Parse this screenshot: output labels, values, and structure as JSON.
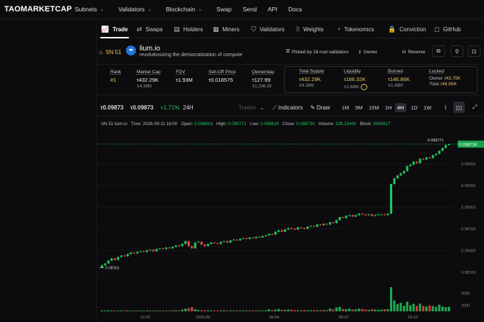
{
  "app": {
    "logo": "TAOMARKETCAP"
  },
  "topnav": [
    {
      "label": "Subnets",
      "chevron": true
    },
    {
      "label": "Validators",
      "chevron": true
    },
    {
      "label": "Blockchain",
      "chevron": true
    },
    {
      "label": "Swap",
      "chevron": false
    },
    {
      "label": "Send",
      "chevron": false
    },
    {
      "label": "API",
      "chevron": false
    },
    {
      "label": "Docs",
      "chevron": false
    }
  ],
  "tabs": [
    {
      "label": "Trade",
      "icon": "chart-line-icon",
      "glyph": "📈"
    },
    {
      "label": "Swaps",
      "icon": "swap-icon",
      "glyph": "⇄"
    },
    {
      "label": "Holders",
      "icon": "holders-icon",
      "glyph": "▤"
    },
    {
      "label": "Miners",
      "icon": "miner-icon",
      "glyph": "▦"
    },
    {
      "label": "Validators",
      "icon": "shield-icon",
      "glyph": "⛉"
    },
    {
      "label": "Weights",
      "icon": "grid-dots-icon",
      "glyph": "⁞⁞"
    },
    {
      "label": "Tokenomics",
      "icon": "pie-icon",
      "glyph": "◔"
    },
    {
      "label": "Conviction",
      "icon": "lock-icon",
      "glyph": "🔒"
    },
    {
      "label": "GitHub",
      "icon": "github-icon",
      "glyph": "◻"
    }
  ],
  "subnet": {
    "sn_label": "SN 51",
    "name": "lium.io",
    "tagline": "revolutionizing the democratization of compute",
    "picked_by": "Picked by 18 root validators",
    "owner": "Owner",
    "reserve": "Reserve"
  },
  "stats": {
    "rank": {
      "label": "Rank",
      "value": "#1"
    },
    "market_cap": {
      "label": "Market Cap",
      "value": "τ432.29K",
      "sub": "π4.38M"
    },
    "fdv": {
      "label": "FDV",
      "value": "τ1.93M"
    },
    "selloff": {
      "label": "Sell-Off Price",
      "value": "τ0.018575"
    },
    "owner_day": {
      "label": "Owner/day",
      "value": "τ127.99",
      "sub": "π1,296.29"
    },
    "total_supply": {
      "label": "Total Supply",
      "value": "τ432.29K",
      "sub": "π4.38M"
    },
    "liquidity": {
      "label": "Liquidity",
      "value": "τ166.32K",
      "sub": "π1.68M"
    },
    "burned": {
      "label": "Burned",
      "value": "τ146.86K",
      "sub": "π1.49M"
    },
    "locked": {
      "label": "Locked",
      "owner_label": "Owner",
      "owner_value": "τ43.75K",
      "total_label": "Total",
      "total_value": "τ48.85K"
    }
  },
  "toolbar": {
    "price1": "τ0.09873",
    "price2": "τ0.09873",
    "change": "+1.71%",
    "period": "24H",
    "trades": "Trades",
    "indicators": "Indicators",
    "draw": "Draw",
    "timeframes": [
      "1M",
      "5M",
      "15M",
      "1H",
      "4H",
      "1D",
      "1W"
    ],
    "active_tf": "4H"
  },
  "info": {
    "symbol": "SN 51 lium.io",
    "time": "Time: 2026-09-11 16:00",
    "open_label": "Open:",
    "open": "0.098618",
    "high_label": "High:",
    "high": "0.098771",
    "low_label": "Low:",
    "low": "0.098618",
    "close_label": "Close:",
    "close": "0.098734",
    "volume_label": "Volume:",
    "volume": "228.25400",
    "block_label": "Block:",
    "block": "9046927"
  },
  "chart_data": {
    "type": "candlestick",
    "price_axis": {
      "ticks": [
        "0.09600",
        "0.09300",
        "0.09000",
        "0.08700",
        "0.08400",
        "0.08100"
      ],
      "min": 0.0798,
      "max": 0.0995
    },
    "volume_axis": {
      "ticks": [
        "6000",
        "2000"
      ],
      "max": 8000
    },
    "x_ticks": [
      "12:00",
      "2026-09",
      "09-04",
      "09-07",
      "09-10"
    ],
    "last_price": "0.098734",
    "high_marker": "0.098771",
    "low_marker": "0.08161",
    "close": [
      0.08195,
      0.0822,
      0.0826,
      0.0829,
      0.0827,
      0.0831,
      0.0833,
      0.0832,
      0.0835,
      0.0837,
      0.0836,
      0.0838,
      0.0839,
      0.0838,
      0.084,
      0.0841,
      0.0839,
      0.0842,
      0.0843,
      0.0842,
      0.0844,
      0.0843,
      0.0845,
      0.0847,
      0.0846,
      0.0849,
      0.0853,
      0.0846,
      0.0843,
      0.0851,
      0.0852,
      0.0848,
      0.0846,
      0.0849,
      0.0851,
      0.085,
      0.0849,
      0.0852,
      0.0853,
      0.0851,
      0.0854,
      0.0855,
      0.0854,
      0.0856,
      0.0857,
      0.0856,
      0.0858,
      0.0857,
      0.0859,
      0.0858,
      0.086,
      0.0861,
      0.0863,
      0.0862,
      0.0866,
      0.0868,
      0.0866,
      0.0869,
      0.0871,
      0.087,
      0.0869,
      0.0872,
      0.0871,
      0.087,
      0.0873,
      0.0874,
      0.0873,
      0.0876,
      0.0875,
      0.0877,
      0.0876,
      0.0879,
      0.0878,
      0.0882,
      0.0886,
      0.0885,
      0.0888,
      0.0889,
      0.0887,
      0.0889,
      0.0891,
      0.089,
      0.0889,
      0.089,
      0.0888,
      0.0889,
      0.089,
      0.089,
      0.0889,
      0.0891,
      0.0932,
      0.094,
      0.0944,
      0.0947,
      0.095,
      0.0957,
      0.0959,
      0.0963,
      0.0961,
      0.0967,
      0.0966,
      0.0969,
      0.0968,
      0.0972,
      0.0974,
      0.0978,
      0.0982,
      0.0986,
      0.09873
    ],
    "volume": [
      300,
      280,
      320,
      260,
      300,
      270,
      310,
      250,
      290,
      260,
      280,
      240,
      300,
      260,
      280,
      270,
      260,
      290,
      250,
      280,
      270,
      260,
      300,
      310,
      280,
      600,
      900,
      1100,
      1400,
      700,
      500,
      400,
      350,
      380,
      300,
      320,
      280,
      300,
      330,
      260,
      320,
      300,
      280,
      300,
      290,
      310,
      280,
      300,
      290,
      320,
      300,
      330,
      700,
      400,
      600,
      800,
      500,
      450,
      600,
      500,
      400,
      380,
      350,
      420,
      380,
      360,
      400,
      350,
      380,
      420,
      400,
      900,
      600,
      1300,
      1500,
      800,
      700,
      900,
      600,
      700,
      900,
      800,
      600,
      500,
      700,
      600,
      500,
      600,
      650,
      700,
      8000,
      3600,
      2400,
      2800,
      1800,
      3200,
      2000,
      2500,
      1800,
      2600,
      1800,
      1600,
      2000,
      1800,
      1500,
      2200,
      1600,
      1400,
      1500
    ]
  }
}
